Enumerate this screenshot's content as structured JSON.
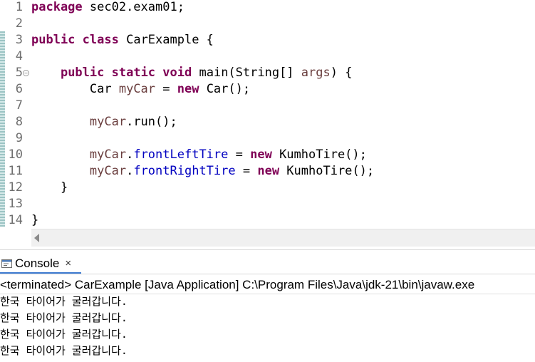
{
  "editor": {
    "lines": [
      {
        "n": "1",
        "segs": [
          {
            "t": "package",
            "c": "kw"
          },
          {
            "t": " sec02.exam01;"
          }
        ]
      },
      {
        "n": "2",
        "segs": []
      },
      {
        "n": "3",
        "segs": [
          {
            "t": "public",
            "c": "kw"
          },
          {
            "t": " "
          },
          {
            "t": "class",
            "c": "kw"
          },
          {
            "t": " CarExample {"
          }
        ]
      },
      {
        "n": "4",
        "segs": []
      },
      {
        "n": "5",
        "fold": true,
        "segs": [
          {
            "t": "    "
          },
          {
            "t": "public",
            "c": "kw"
          },
          {
            "t": " "
          },
          {
            "t": "static",
            "c": "kw"
          },
          {
            "t": " "
          },
          {
            "t": "void",
            "c": "kw"
          },
          {
            "t": " main(String[] "
          },
          {
            "t": "args",
            "c": "var"
          },
          {
            "t": ") {"
          }
        ]
      },
      {
        "n": "6",
        "segs": [
          {
            "t": "        Car "
          },
          {
            "t": "myCar",
            "c": "var"
          },
          {
            "t": " = "
          },
          {
            "t": "new",
            "c": "kw"
          },
          {
            "t": " Car();"
          }
        ]
      },
      {
        "n": "7",
        "segs": []
      },
      {
        "n": "8",
        "segs": [
          {
            "t": "        "
          },
          {
            "t": "myCar",
            "c": "var"
          },
          {
            "t": ".run();"
          }
        ]
      },
      {
        "n": "9",
        "segs": []
      },
      {
        "n": "10",
        "segs": [
          {
            "t": "        "
          },
          {
            "t": "myCar",
            "c": "var"
          },
          {
            "t": "."
          },
          {
            "t": "frontLeftTire",
            "c": "fld"
          },
          {
            "t": " = "
          },
          {
            "t": "new",
            "c": "kw"
          },
          {
            "t": " KumhoTire();"
          }
        ]
      },
      {
        "n": "11",
        "segs": [
          {
            "t": "        "
          },
          {
            "t": "myCar",
            "c": "var"
          },
          {
            "t": "."
          },
          {
            "t": "frontRightTire",
            "c": "fld"
          },
          {
            "t": " = "
          },
          {
            "t": "new",
            "c": "kw"
          },
          {
            "t": " KumhoTire();"
          }
        ]
      },
      {
        "n": "12",
        "segs": [
          {
            "t": "    }"
          }
        ]
      },
      {
        "n": "13",
        "segs": []
      },
      {
        "n": "14",
        "segs": [
          {
            "t": "}"
          }
        ]
      }
    ],
    "colors": {
      "keyword": "#7f0055",
      "local_variable": "#6a3e3e",
      "field": "#0000c0"
    }
  },
  "console": {
    "tab_label": "Console",
    "close_glyph": "×",
    "terminated": "<terminated> CarExample [Java Application] C:\\Program Files\\Java\\jdk-21\\bin\\javaw.exe",
    "output": [
      "한국 타이어가 굴러갑니다.",
      "한국 타이어가 굴러갑니다.",
      "한국 타이어가 굴러갑니다.",
      "한국 타이어가 굴러갑니다."
    ],
    "icons": {
      "tab_icon": "console-icon",
      "close_icon": "close-icon",
      "scroll_left_icon": "scroll-left-arrow-icon"
    },
    "accent_color": "#3e7bd1"
  }
}
